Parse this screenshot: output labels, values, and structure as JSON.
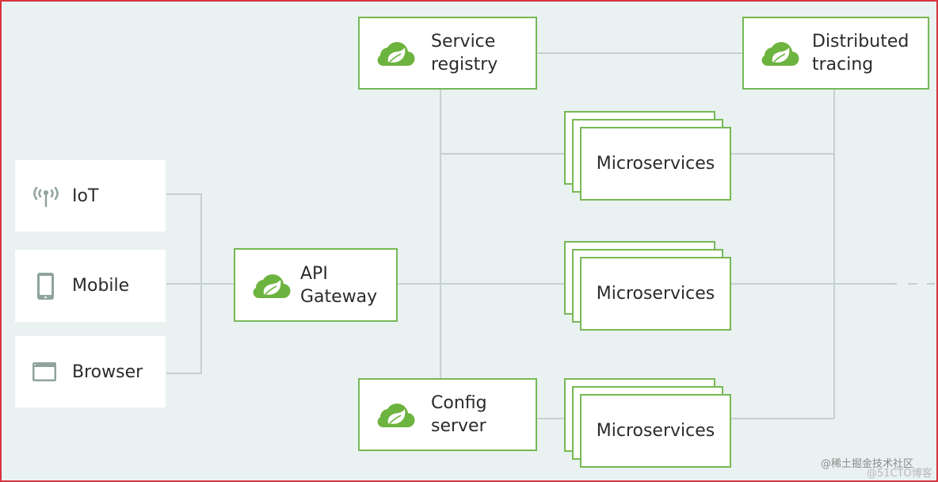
{
  "diagram": {
    "clients": [
      {
        "label": "IoT",
        "icon": "antenna-icon"
      },
      {
        "label": "Mobile",
        "icon": "mobile-phone-icon"
      },
      {
        "label": "Browser",
        "icon": "browser-window-icon"
      }
    ],
    "api_gateway": {
      "line1": "API",
      "line2": "Gateway",
      "icon": "spring-cloud-icon"
    },
    "service_registry": {
      "line1": "Service",
      "line2": "registry",
      "icon": "spring-cloud-icon"
    },
    "config_server": {
      "line1": "Config",
      "line2": "server",
      "icon": "spring-cloud-icon"
    },
    "distributed_tracing": {
      "line1": "Distributed",
      "line2": "tracing",
      "icon": "spring-cloud-icon"
    },
    "microservices": [
      {
        "label": "Microservices"
      },
      {
        "label": "Microservices"
      },
      {
        "label": "Microservices"
      }
    ],
    "colors": {
      "accent_green": "#6db33f",
      "border_green": "#77b855",
      "line_gray": "#c7d0d0",
      "background": "#e9f1f1",
      "frame_red": "#d9333f"
    }
  },
  "watermark": {
    "primary": "@稀土掘金技术社区",
    "secondary": "@51CTO博客"
  }
}
